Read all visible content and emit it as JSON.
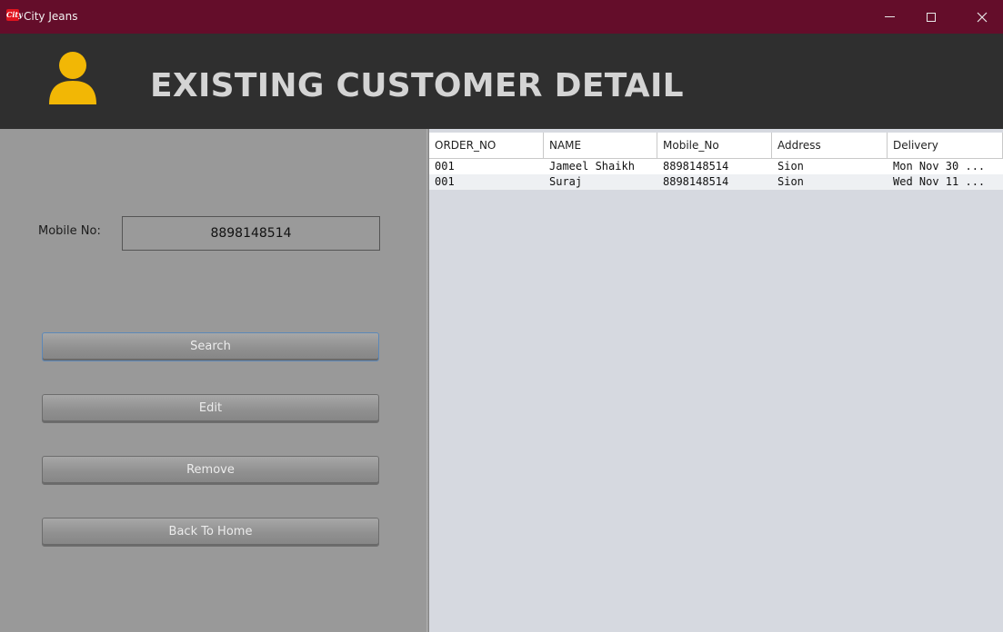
{
  "window": {
    "title": "City Jeans",
    "logo_text": "City",
    "controls": {
      "minimize": "—",
      "maximize": "☐",
      "close": "✕"
    }
  },
  "header": {
    "title": "EXISTING CUSTOMER DETAIL",
    "icon": "user-icon",
    "icon_color": "#f2b705"
  },
  "form": {
    "mobile_label": "Mobile No:",
    "mobile_value": "8898148514"
  },
  "buttons": {
    "search": "Search",
    "edit": "Edit",
    "remove": "Remove",
    "back_home": "Back To Home"
  },
  "table": {
    "columns": [
      "ORDER_NO",
      "NAME",
      "Mobile_No",
      "Address",
      "Delivery"
    ],
    "rows": [
      [
        "001",
        "Jameel Shaikh",
        "8898148514",
        "Sion",
        "Mon Nov 30 ..."
      ],
      [
        "001",
        "Suraj",
        "8898148514",
        "Sion",
        "Wed Nov 11 ..."
      ]
    ]
  },
  "colors": {
    "titlebar": "#640d2a",
    "header": "#2f2f2f",
    "panel": "#999999",
    "table_bg": "#d6d9e0"
  }
}
